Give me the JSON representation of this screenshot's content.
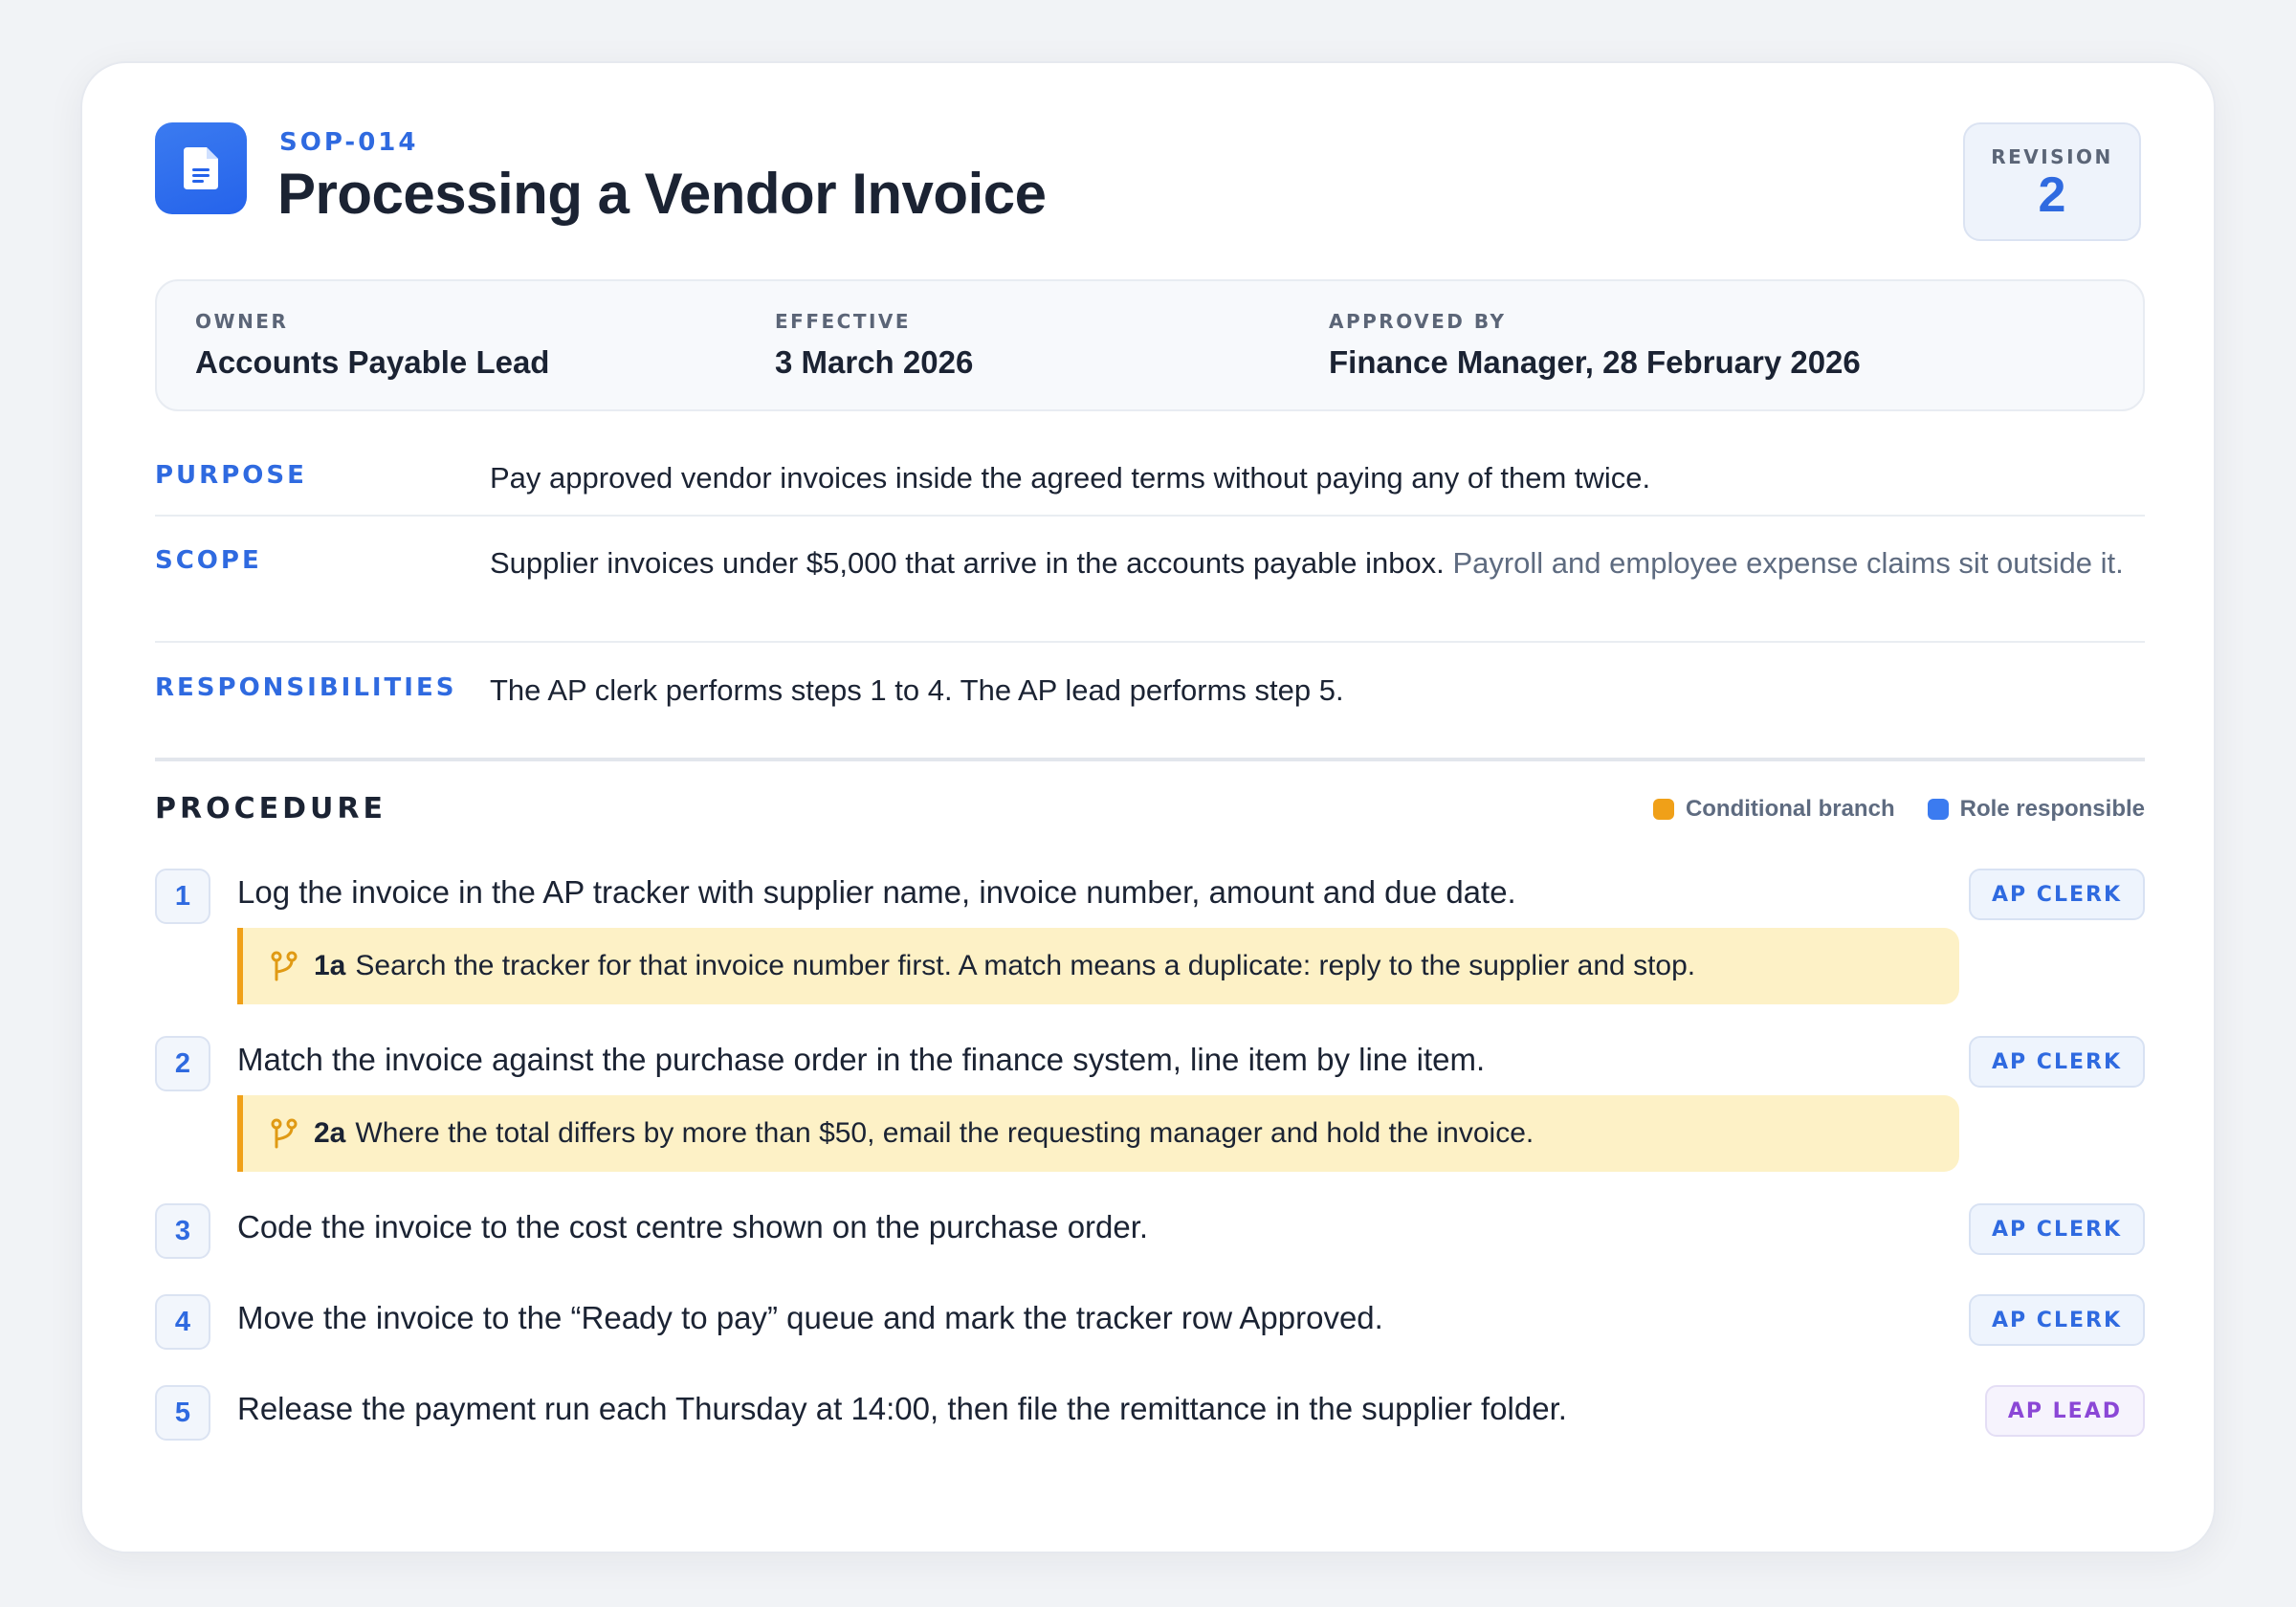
{
  "doc": {
    "id": "SOP-014",
    "title": "Processing a Vendor Invoice",
    "revision_label": "REVISION",
    "revision_value": "2"
  },
  "meta": {
    "owner_label": "OWNER",
    "owner_value": "Accounts Payable Lead",
    "effective_label": "EFFECTIVE",
    "effective_value": "3 March 2026",
    "approved_label": "APPROVED BY",
    "approved_value": "Finance Manager, 28 February 2026"
  },
  "sections": {
    "purpose_label": "PURPOSE",
    "purpose_text": "Pay approved vendor invoices inside the agreed terms without paying any of them twice.",
    "scope_label": "SCOPE",
    "scope_text": "Supplier invoices under $5,000 that arrive in the accounts payable inbox.",
    "scope_note": "Payroll and employee expense claims sit outside it.",
    "resp_label": "RESPONSIBILITIES",
    "resp_text": "The AP clerk performs steps 1 to 4. The AP lead performs step 5."
  },
  "procedure": {
    "title": "PROCEDURE",
    "legend": [
      {
        "label": "Conditional branch",
        "color": "#f0a018"
      },
      {
        "label": "Role responsible",
        "color": "#3b7bf0"
      }
    ],
    "steps": [
      {
        "num": "1",
        "text": "Log the invoice in the AP tracker with supplier name, invoice number, amount and due date.",
        "role": "AP CLERK",
        "branch_id": "1a",
        "branch_text": "Search the tracker for that invoice number first. A match means a duplicate: reply to the supplier and stop."
      },
      {
        "num": "2",
        "text": "Match the invoice against the purchase order in the finance system, line item by line item.",
        "role": "AP CLERK",
        "branch_id": "2a",
        "branch_text": "Where the total differs by more than $50, email the requesting manager and hold the invoice."
      },
      {
        "num": "3",
        "text": "Code the invoice to the cost centre shown on the purchase order.",
        "role": "AP CLERK"
      },
      {
        "num": "4",
        "text": "Move the invoice to the “Ready to pay” queue and mark the tracker row Approved.",
        "role": "AP CLERK"
      },
      {
        "num": "5",
        "text": "Release the payment run each Thursday at 14:00, then file the remittance in the supplier folder.",
        "role": "AP LEAD"
      }
    ]
  },
  "colors": {
    "accent": "#2f6ae0",
    "branch": "#f0a018",
    "branch_bg": "#fdf1c6",
    "lead": "#8b47d6"
  }
}
